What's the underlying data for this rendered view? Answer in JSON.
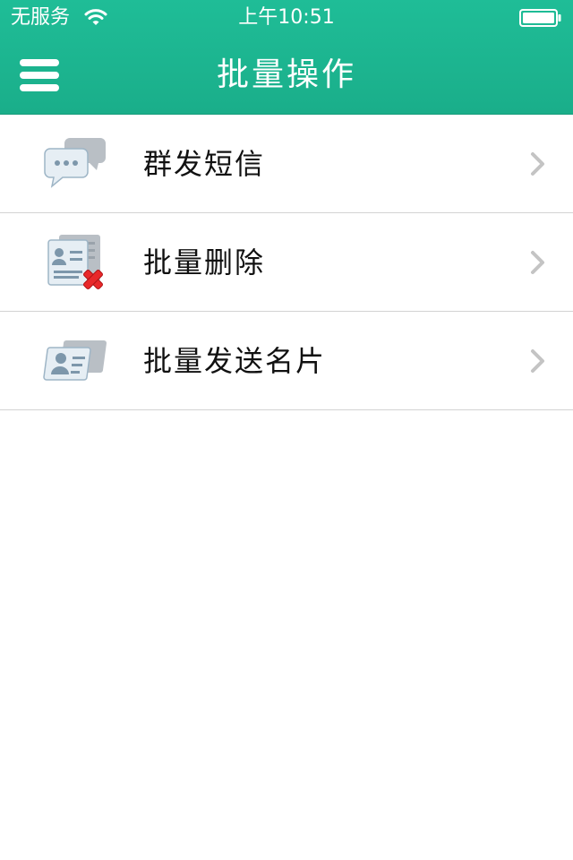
{
  "status_bar": {
    "carrier": "无服务",
    "time": "上午10:51",
    "wifi_icon": "wifi-icon",
    "battery_icon": "battery-icon"
  },
  "nav_bar": {
    "title": "批量操作",
    "menu_icon": "hamburger-menu-icon"
  },
  "colors": {
    "header": "#1db893",
    "divider": "#d3d3d3",
    "text": "#111111",
    "chevron": "#c4c4c4"
  },
  "list": {
    "items": [
      {
        "label": "群发短信",
        "icon": "chat-bubbles-icon"
      },
      {
        "label": "批量删除",
        "icon": "delete-contact-icon"
      },
      {
        "label": "批量发送名片",
        "icon": "business-cards-icon"
      }
    ]
  }
}
